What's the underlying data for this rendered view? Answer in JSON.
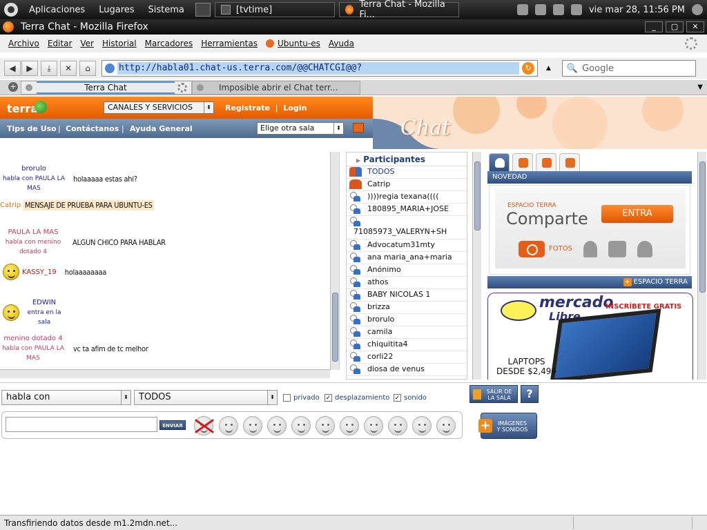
{
  "panel": {
    "menus": [
      "Aplicaciones",
      "Lugares",
      "Sistema"
    ],
    "tasks": [
      "[tvtime]",
      "Terra Chat - Mozilla Fi..."
    ],
    "clock": "vie mar 28, 11:56 PM"
  },
  "window": {
    "title": "Terra Chat - Mozilla Firefox"
  },
  "menubar": {
    "items": [
      "Archivo",
      "Editar",
      "Ver",
      "Historial",
      "Marcadores",
      "Herramientas",
      "Ubuntu-es",
      "Ayuda"
    ]
  },
  "navbar": {
    "url": "http://habla01.chat-us.terra.com/@@CHATCGI@@?",
    "search_placeholder": "Google"
  },
  "tabs": [
    {
      "label": "Terra Chat"
    },
    {
      "label": "Imposible abrir el Chat terr..."
    }
  ],
  "terra": {
    "logo": "terra",
    "canales": "CANALES Y SERVICIOS",
    "registrate": "Registrate",
    "login": "Login",
    "sep": "|",
    "links": [
      "Tips de Uso",
      "Contáctanos",
      "Ayuda General"
    ],
    "sala_select": "Elige otra sala",
    "chat_word": "Chat"
  },
  "messages": [
    {
      "nick": "brorulo",
      "sub": "habla con PAULA LA MAS",
      "text": "holaaaaa estas ahi?"
    },
    {
      "nick": "Catrip",
      "sub": "",
      "text": "MENSAJE DE PRUEBA PARA UBUNTU-ES"
    },
    {
      "nick": "PAULA LA MAS",
      "sub": "habla con menino dotado 4",
      "text": "ALGUN CHICO PARA HABLAR"
    },
    {
      "nick": "KASSY_19",
      "sub": "",
      "text": "holaaaaaaaa"
    },
    {
      "nick": "EDWIN",
      "sub": "entra en la sala",
      "text": ""
    },
    {
      "nick": "menino dotado 4",
      "sub": "habla con PAULA LA MAS",
      "text": "vc ta afim de tc melhor"
    }
  ],
  "participants": {
    "title": "Participantes",
    "list": [
      "TODOS",
      "Catrip",
      "))))regia texana((((",
      "180895_MARIA+JOSE",
      "71085973_VALERYN+SH",
      "Advocatum31mty",
      "ana maria_ana+maria",
      "Anónimo",
      "athos",
      "BABY NICOLAS 1",
      "brizza",
      "brorulo",
      "camila",
      "chiquitita4",
      "corli22",
      "diosa de venus"
    ]
  },
  "rpanel": {
    "novedad": "NOVEDAD",
    "espacio_small": "ESPACIO TERRA",
    "espacio_big": "Comparte",
    "entra": "ENTRA",
    "fotos": "FOTOS",
    "espacio_bar": "ESPACIO TERRA",
    "ml_line1": "mercado",
    "ml_line2": "Libre",
    "ml_ins": "INSCRÍBETE GRATIS",
    "laptop_line1": "LAPTOPS",
    "laptop_line2": "DESDE $2,499"
  },
  "controls": {
    "habla_con": "habla con",
    "target": "TODOS",
    "privado": "privado",
    "desplazamiento": "desplazamiento",
    "sonido": "sonido",
    "salir_1": "SALIR DE",
    "salir_2": "LA SALA",
    "help": "?",
    "enviar": "ENVIAR",
    "imagenes_1": "IMÁGENES",
    "imagenes_2": "Y SONIDOS"
  },
  "status": {
    "text": "Transfiriendo datos desde m1.2mdn.net..."
  }
}
